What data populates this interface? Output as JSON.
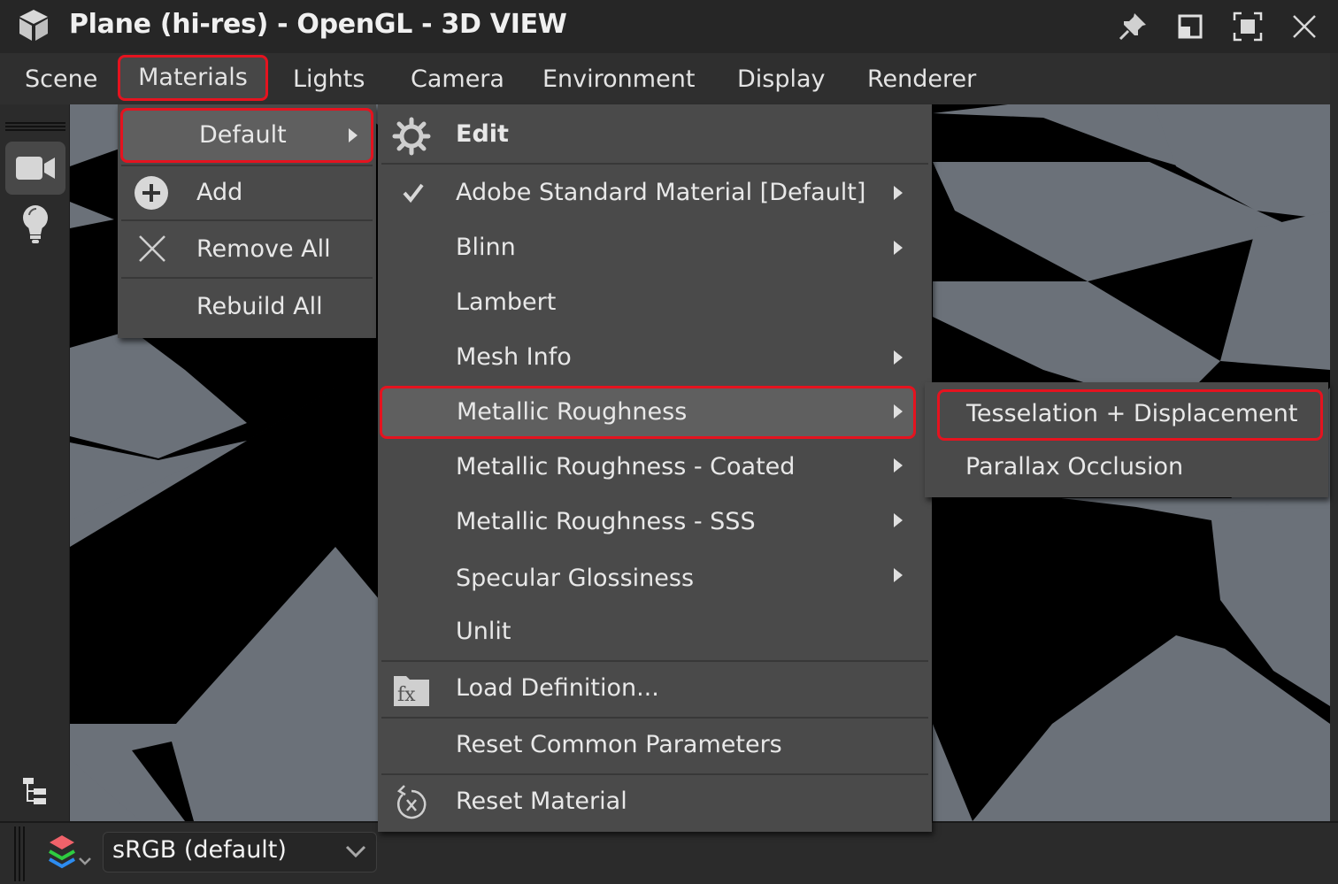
{
  "window": {
    "title": "Plane (hi-res) - OpenGL - 3D VIEW",
    "controls": [
      "pin",
      "restore-float",
      "maximize",
      "close"
    ]
  },
  "menubar": {
    "items": [
      {
        "label": "Scene"
      },
      {
        "label": "Materials",
        "active": true
      },
      {
        "label": "Lights"
      },
      {
        "label": "Camera"
      },
      {
        "label": "Environment"
      },
      {
        "label": "Display"
      },
      {
        "label": "Renderer"
      }
    ]
  },
  "left_toolbar": {
    "tools": [
      {
        "icon": "camera-icon",
        "active": true
      },
      {
        "icon": "lightbulb-icon",
        "active": false
      },
      {
        "icon": "hierarchy-icon",
        "active": false
      }
    ]
  },
  "materials_menu": {
    "items": [
      {
        "label": "Default",
        "icon": "",
        "has_submenu": true,
        "highlighted": true
      },
      {
        "label": "Add",
        "icon": "plus-circle-icon"
      },
      {
        "label": "Remove All",
        "icon": "x-icon"
      },
      {
        "label": "Rebuild All",
        "icon": ""
      }
    ]
  },
  "default_submenu": {
    "items": [
      {
        "label": "Edit",
        "icon": "gear-icon"
      },
      {
        "label": "Adobe Standard Material [Default]",
        "checked": true,
        "has_submenu": true
      },
      {
        "label": "Blinn",
        "has_submenu": true
      },
      {
        "label": "Lambert",
        "has_submenu": false
      },
      {
        "label": "Mesh Info",
        "has_submenu": true
      },
      {
        "label": "Metallic Roughness",
        "has_submenu": true,
        "highlighted": true
      },
      {
        "label": "Metallic Roughness - Coated",
        "has_submenu": true
      },
      {
        "label": "Metallic Roughness - SSS",
        "has_submenu": true
      },
      {
        "label": "Specular Glossiness",
        "has_submenu": true
      },
      {
        "label": "Unlit",
        "has_submenu": false
      },
      {
        "label": "Load Definition...",
        "icon": "fx-folder-icon"
      },
      {
        "label": "Reset Common Parameters"
      },
      {
        "label": "Reset Material",
        "icon": "reset-icon"
      }
    ]
  },
  "metallic_roughness_submenu": {
    "items": [
      {
        "label": "Tesselation + Displacement",
        "highlighted": true
      },
      {
        "label": "Parallax Occlusion"
      }
    ]
  },
  "bottombar": {
    "layers_icon": "layers-icon",
    "colorspace": {
      "value": "sRGB (default)"
    }
  },
  "colors": {
    "highlight_border": "#e5131f",
    "menu_bg": "#4a4a4a",
    "hover_bg": "#5f5f5f",
    "checker_light": "#6b7179",
    "checker_dark": "#000000"
  }
}
